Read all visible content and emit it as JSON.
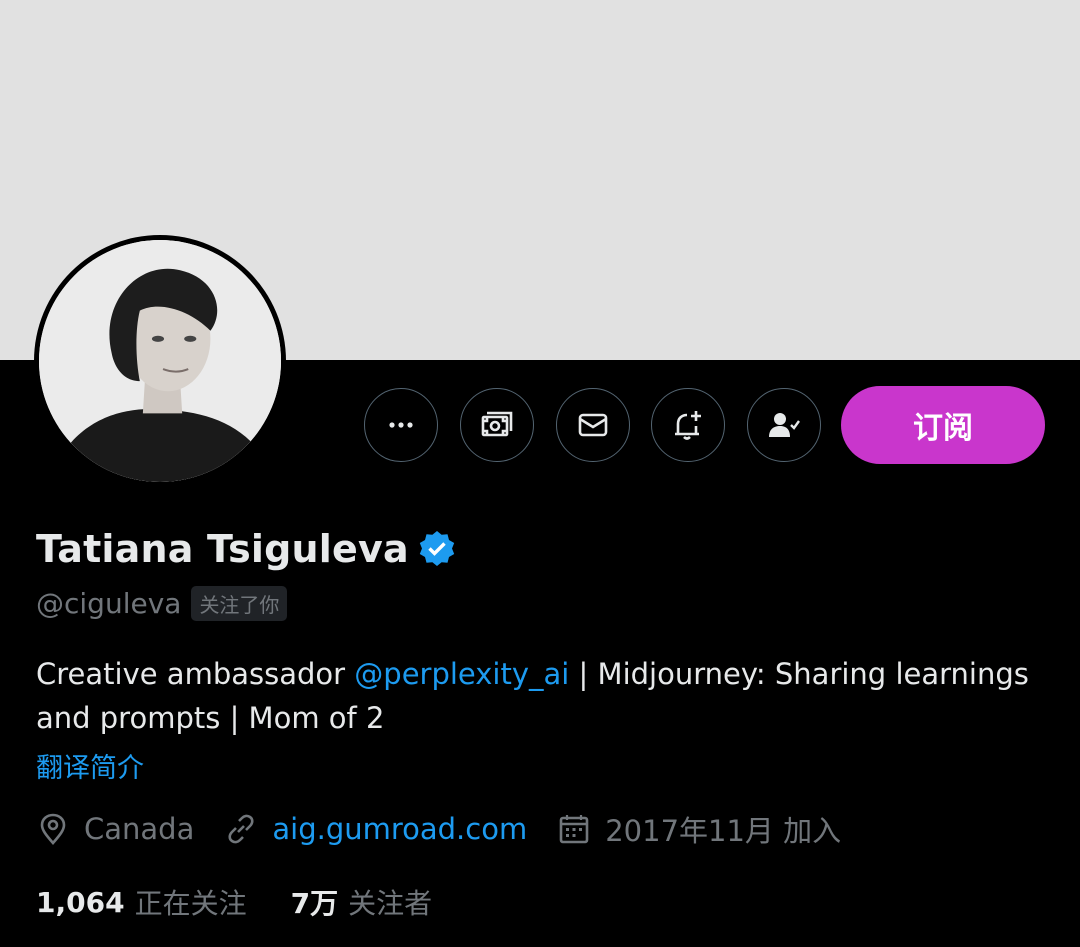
{
  "profile": {
    "name": "Tatiana Tsiguleva",
    "handle": "@ciguleva",
    "follows_you_badge": "关注了你",
    "bio": {
      "prefix": "Creative ambassador ",
      "mention": "@perplexity_ai",
      "suffix": " | Midjourney: Sharing learnings and prompts | Mom of 2"
    },
    "translate_label": "翻译简介",
    "location": "Canada",
    "website": "aig.gumroad.com",
    "joined": "2017年11月 加入",
    "following_count": "1,064",
    "following_label": "正在关注",
    "followers_count": "7万",
    "followers_label": "关注者"
  },
  "actions": {
    "subscribe_label": "订阅",
    "icons": [
      "more-icon",
      "money-icon",
      "mail-icon",
      "bell-plus-icon",
      "following-icon"
    ]
  },
  "colors": {
    "background": "#000000",
    "banner": "#e1e1e1",
    "accent_link": "#1d9bf0",
    "subscribe_button": "#c936cc",
    "muted_text": "#71767b"
  }
}
